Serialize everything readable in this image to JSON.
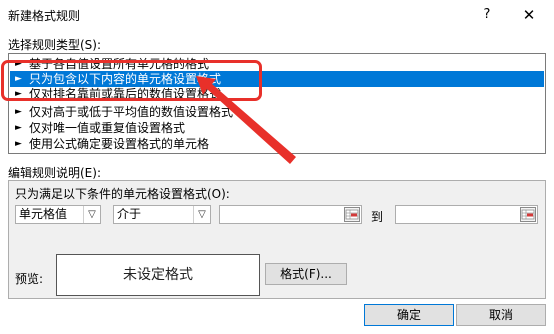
{
  "window": {
    "title": "新建格式规则",
    "help_label": "?",
    "close_label": "✕"
  },
  "rule_type": {
    "label": "选择规则类型(S):",
    "items": [
      {
        "label": "基于各自值设置所有单元格的格式"
      },
      {
        "label": "只为包含以下内容的单元格设置格式"
      },
      {
        "label": "仅对排名靠前或靠后的数值设置格式"
      },
      {
        "label": "仅对高于或低于平均值的数值设置格式"
      },
      {
        "label": "仅对唯一值或重复值设置格式"
      },
      {
        "label": "使用公式确定要设置格式的单元格"
      }
    ],
    "selected_index": 1,
    "bullet": "►"
  },
  "rule_description": {
    "label": "编辑规则说明(E):",
    "condition_label": "只为满足以下条件的单元格设置格式(O):",
    "field_select": {
      "value": "单元格值",
      "icon": "dropdown-arrow-icon"
    },
    "operator_select": {
      "value": "介于",
      "icon": "dropdown-arrow-icon"
    },
    "from_value": "",
    "to_label": "到",
    "to_value": "",
    "range_picker_icon": "range-selector-icon"
  },
  "preview": {
    "label": "预览:",
    "sample_text": "未设定格式",
    "format_button": "格式(F)..."
  },
  "actions": {
    "ok": "确定",
    "cancel": "取消"
  },
  "colors": {
    "selection": "#0078d7",
    "annotation": "#e8302a"
  }
}
